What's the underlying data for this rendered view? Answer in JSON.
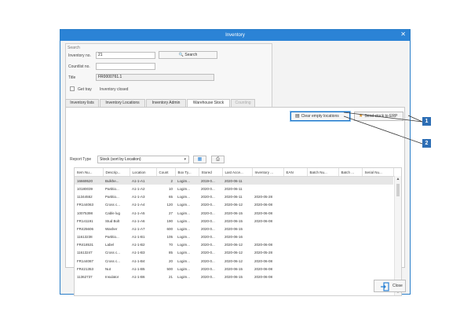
{
  "window": {
    "title": "Inventory",
    "close_glyph": "✕"
  },
  "search": {
    "group_label": "Search",
    "inventory_no_label": "Inventory no.",
    "inventory_no_value": "21",
    "search_button": "Search",
    "countlist_no_label": "Countlist no.",
    "countlist_no_value": "",
    "title_label": "Title",
    "title_value": "FR0000761.1",
    "get_tray_label": "Get tray",
    "inventory_closed_label": "Inventory closed"
  },
  "tabs": [
    {
      "label": "Inventory lists",
      "active": false,
      "enabled": true
    },
    {
      "label": "Inventory Locations",
      "active": false,
      "enabled": true
    },
    {
      "label": "Inventory Admin",
      "active": false,
      "enabled": true
    },
    {
      "label": "Warehouse Stock",
      "active": true,
      "enabled": true
    },
    {
      "label": "Counting",
      "active": false,
      "enabled": false
    }
  ],
  "toolbar": {
    "clear_empty_locations": "Clear empty locations",
    "send_stock_to_erp": "Send stock to ERP",
    "report_type_label": "Report Type",
    "report_type_value": "Stock (sort by Location)"
  },
  "table": {
    "columns": [
      "Item Nu...",
      "Descrip...",
      "Location",
      "Count",
      "Box Ty...",
      "Stored",
      "Last Acce...",
      "Inventory ...",
      "EAN",
      "Batch Nu...",
      "Batch ...",
      "Serial Nu..."
    ],
    "rows": [
      [
        "16669520",
        "Bulkhe...",
        "A1-1-A1",
        "2",
        "Logim...",
        "2019-0...",
        "2020-06-11",
        "",
        "",
        "",
        "",
        ""
      ],
      [
        "10180039",
        "Partitio...",
        "A1-1-A2",
        "10",
        "Logim...",
        "2020-0...",
        "2020-06-11",
        "",
        "",
        "",
        "",
        ""
      ],
      [
        "11344552",
        "Partitio...",
        "A1-1-A3",
        "65",
        "Logim...",
        "2020-0...",
        "2020-06-11",
        "2020-05-28",
        "",
        "",
        "",
        ""
      ],
      [
        "FR144063",
        "Cross c...",
        "A1-1-A4",
        "120",
        "Logim...",
        "2020-0...",
        "2020-06-12",
        "2020-06-08",
        "",
        "",
        "",
        ""
      ],
      [
        "10075398",
        "Cable lug",
        "A1-1-A5",
        "27",
        "Logim...",
        "2020-0...",
        "2020-06-15",
        "2020-06-08",
        "",
        "",
        "",
        ""
      ],
      [
        "FR141191",
        "Stud Bolt",
        "A1-1-A6",
        "190",
        "Logim...",
        "2020-0...",
        "2020-06-15",
        "2020-06-08",
        "",
        "",
        "",
        ""
      ],
      [
        "FR425606",
        "Washer",
        "A1-1-A7",
        "600",
        "Logim...",
        "2020-0...",
        "2020-06-15",
        "",
        "",
        "",
        "",
        ""
      ],
      [
        "11613238",
        "Partitio...",
        "A1-1-B1",
        "105",
        "Logim...",
        "2020-0...",
        "2020-06-16",
        "",
        "",
        "",
        "",
        ""
      ],
      [
        "FR418531",
        "Label",
        "A1-1-B2",
        "70",
        "Logim...",
        "2020-0...",
        "2020-06-12",
        "2020-06-08",
        "",
        "",
        "",
        ""
      ],
      [
        "11613247",
        "Cross c...",
        "A1-1-B3",
        "85",
        "Logim...",
        "2020-0...",
        "2020-06-12",
        "2020-05-28",
        "",
        "",
        "",
        ""
      ],
      [
        "FR144087",
        "Cross c...",
        "A1-1-B4",
        "20",
        "Logim...",
        "2020-0...",
        "2020-06-12",
        "2020-06-08",
        "",
        "",
        "",
        ""
      ],
      [
        "FR421353",
        "Nut",
        "A1-1-B5",
        "500",
        "Logim...",
        "2020-0...",
        "2020-06-15",
        "2020-06-08",
        "",
        "",
        "",
        ""
      ],
      [
        "11362737",
        "Insulator",
        "A1-1-B6",
        "21",
        "Logim...",
        "2020-0...",
        "2020-06-15",
        "2020-06-08",
        "",
        "",
        "",
        ""
      ]
    ]
  },
  "footer": {
    "close_button": "Close"
  },
  "callouts": [
    "1",
    "2"
  ],
  "icons": {
    "search": "search-icon",
    "clear": "broom-icon",
    "send": "erp-send-icon",
    "excel": "excel-icon",
    "print": "print-icon",
    "close": "exit-icon"
  },
  "colors": {
    "titlebar": "#2b83d6",
    "callout": "#2d6eb5",
    "highlight": "#1a73c8"
  }
}
